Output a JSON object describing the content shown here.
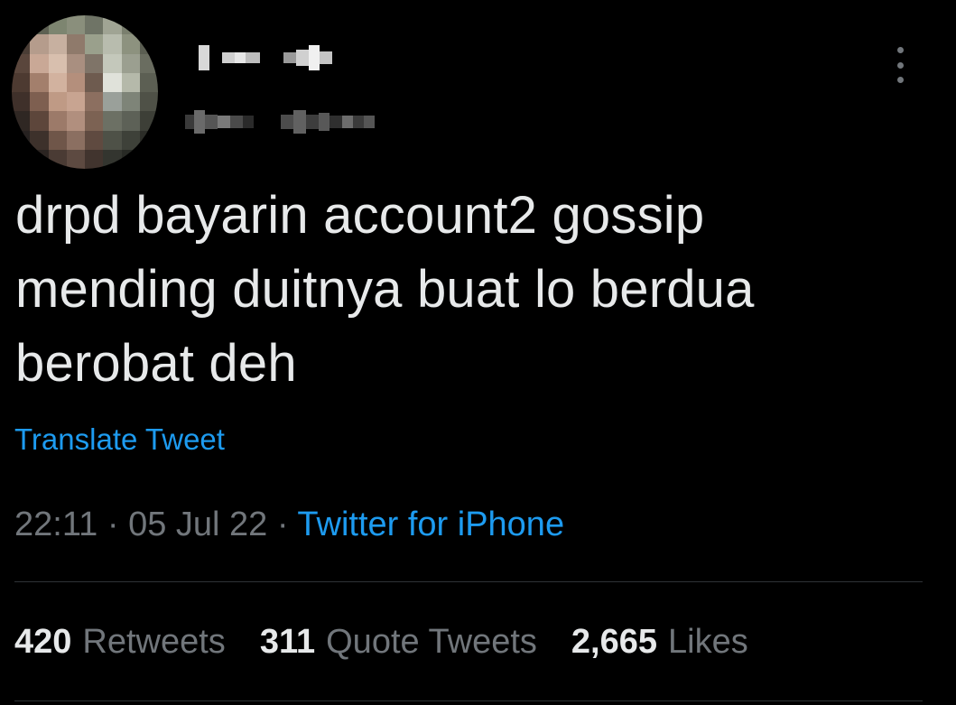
{
  "tweet": {
    "text_lines": [
      "drpd bayarin account2 gossip",
      "mending duitnya buat lo berdua",
      "berobat deh"
    ],
    "translate_label": "Translate Tweet",
    "time": "22:11",
    "date": "05 Jul 22",
    "separator": "·",
    "source": "Twitter for iPhone",
    "stats": {
      "retweets_count": "420",
      "retweets_label": "Retweets",
      "quotes_count": "311",
      "quotes_label": "Quote Tweets",
      "likes_count": "2,665",
      "likes_label": "Likes"
    }
  },
  "icons": {
    "avatar": "pixelated-avatar",
    "more": "more-options-icon"
  },
  "colors": {
    "background": "#000000",
    "text": "#e7e9ea",
    "muted": "#71767b",
    "accent": "#1d9bf0",
    "divider": "#2f3336"
  }
}
